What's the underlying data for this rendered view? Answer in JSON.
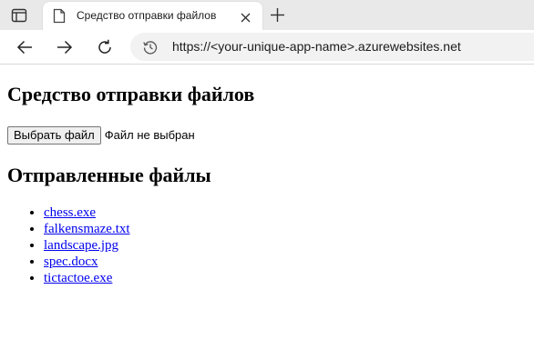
{
  "browser": {
    "tab": {
      "title": "Средство отправки файлов"
    },
    "address_bar": {
      "url": "https://<your-unique-app-name>.azurewebsites.net"
    },
    "icons": [
      "tab-actions-icon",
      "page-favicon-icon",
      "close-icon",
      "plus-icon",
      "back-arrow-icon",
      "forward-arrow-icon",
      "reload-icon",
      "site-info-icon"
    ]
  },
  "page": {
    "heading": "Средство отправки файлов",
    "file_input": {
      "button_label": "Выбрать файл",
      "status": "Файл не выбран"
    },
    "uploaded_heading": "Отправленные файлы",
    "files": [
      {
        "name": "chess.exe"
      },
      {
        "name": "falkensmaze.txt"
      },
      {
        "name": "landscape.jpg"
      },
      {
        "name": "spec.docx"
      },
      {
        "name": "tictactoe.exe"
      }
    ]
  },
  "colors": {
    "link": "#0000ee",
    "tabbar_bg": "#e9e9e9",
    "addressbar_bg": "#f2f2f2"
  }
}
